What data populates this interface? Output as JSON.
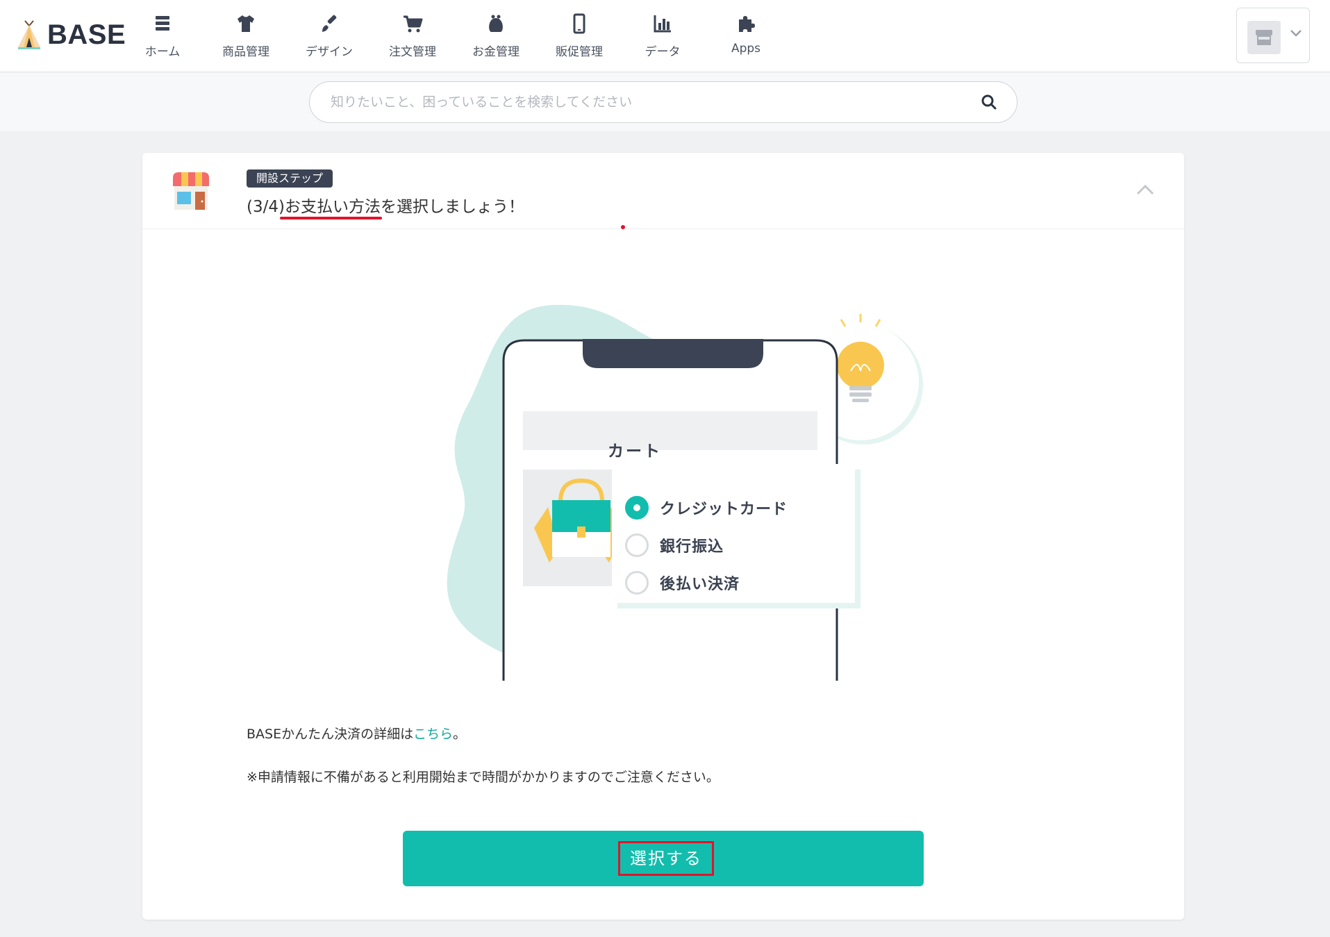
{
  "brand": {
    "name": "BASE"
  },
  "nav": {
    "items": [
      {
        "label": "ホーム",
        "icon": "home-list-icon"
      },
      {
        "label": "商品管理",
        "icon": "tshirt-icon"
      },
      {
        "label": "デザイン",
        "icon": "brush-icon"
      },
      {
        "label": "注文管理",
        "icon": "cart-icon"
      },
      {
        "label": "お金管理",
        "icon": "coin-purse-icon"
      },
      {
        "label": "販促管理",
        "icon": "smartphone-icon"
      },
      {
        "label": "データ",
        "icon": "bar-chart-icon"
      },
      {
        "label": "Apps",
        "icon": "puzzle-icon"
      }
    ]
  },
  "search": {
    "placeholder": "知りたいこと、困っていることを検索してください"
  },
  "card": {
    "badge": "開設ステップ",
    "title": "(3/4)お支払い方法を選択しましょう！",
    "illustration": {
      "cart_label": "カート",
      "payment_options": [
        {
          "label": "クレジットカード",
          "selected": true
        },
        {
          "label": "銀行振込",
          "selected": false
        },
        {
          "label": "後払い決済",
          "selected": false
        }
      ]
    },
    "info_prefix": "BASEかんたん決済の詳細は",
    "info_link": "こちら",
    "info_suffix": "。",
    "notice": "※申請情報に不備があると利用開始まで時間がかかりますのでご注意ください。",
    "cta_label": "選択する"
  },
  "colors": {
    "accent": "#13bdad",
    "nav_icon": "#3b4354",
    "highlight": "#e0142c"
  }
}
